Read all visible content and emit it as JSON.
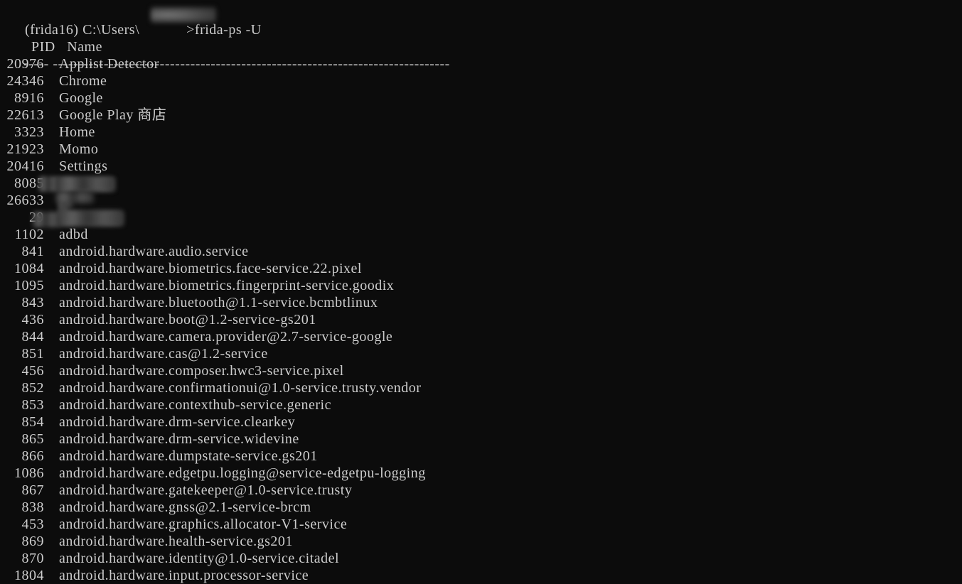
{
  "terminal": {
    "background_color": "#0c0c0c",
    "foreground_color": "#cccccc",
    "prompt": {
      "env": "(frida16)",
      "path_prefix": "C:\\Users\\",
      "path_redacted": "[redacted-username]",
      "path_suffix": ">",
      "command": "frida-ps -U",
      "full_text": "(frida16) C:\\Users\\            >frida-ps -U"
    },
    "header": {
      "pid_label": "PID",
      "name_label": "Name",
      "pid_rule": "-----",
      "name_rule": "------------------------------------------------------------------------------"
    },
    "processes": [
      {
        "pid": "20976",
        "name": "Applist Detector",
        "redacted": false
      },
      {
        "pid": "24346",
        "name": "Chrome",
        "redacted": false
      },
      {
        "pid": "8916",
        "name": "Google",
        "redacted": false
      },
      {
        "pid": "22613",
        "name": "Google Play 商店",
        "redacted": false
      },
      {
        "pid": "3323",
        "name": "Home",
        "redacted": false
      },
      {
        "pid": "21923",
        "name": "Momo",
        "redacted": false
      },
      {
        "pid": "20416",
        "name": "Settings",
        "redacted": false
      },
      {
        "pid": "8085",
        "name": "",
        "redacted": true,
        "redact_width": 78,
        "pid_redacted": true
      },
      {
        "pid": "26633",
        "name": "",
        "redacted": true,
        "redact_width": 20,
        "pid_redacted": false
      },
      {
        "pid": "29",
        "name": "",
        "redacted": true,
        "redact_width": 90,
        "pid_redacted": true
      },
      {
        "pid": "1102",
        "name": "adbd",
        "redacted": false
      },
      {
        "pid": "841",
        "name": "android.hardware.audio.service",
        "redacted": false
      },
      {
        "pid": "1084",
        "name": "android.hardware.biometrics.face-service.22.pixel",
        "redacted": false
      },
      {
        "pid": "1095",
        "name": "android.hardware.biometrics.fingerprint-service.goodix",
        "redacted": false
      },
      {
        "pid": "843",
        "name": "android.hardware.bluetooth@1.1-service.bcmbtlinux",
        "redacted": false
      },
      {
        "pid": "436",
        "name": "android.hardware.boot@1.2-service-gs201",
        "redacted": false
      },
      {
        "pid": "844",
        "name": "android.hardware.camera.provider@2.7-service-google",
        "redacted": false
      },
      {
        "pid": "851",
        "name": "android.hardware.cas@1.2-service",
        "redacted": false
      },
      {
        "pid": "456",
        "name": "android.hardware.composer.hwc3-service.pixel",
        "redacted": false
      },
      {
        "pid": "852",
        "name": "android.hardware.confirmationui@1.0-service.trusty.vendor",
        "redacted": false
      },
      {
        "pid": "853",
        "name": "android.hardware.contexthub-service.generic",
        "redacted": false
      },
      {
        "pid": "854",
        "name": "android.hardware.drm-service.clearkey",
        "redacted": false
      },
      {
        "pid": "865",
        "name": "android.hardware.drm-service.widevine",
        "redacted": false
      },
      {
        "pid": "866",
        "name": "android.hardware.dumpstate-service.gs201",
        "redacted": false
      },
      {
        "pid": "1086",
        "name": "android.hardware.edgetpu.logging@service-edgetpu-logging",
        "redacted": false
      },
      {
        "pid": "867",
        "name": "android.hardware.gatekeeper@1.0-service.trusty",
        "redacted": false
      },
      {
        "pid": "838",
        "name": "android.hardware.gnss@2.1-service-brcm",
        "redacted": false
      },
      {
        "pid": "453",
        "name": "android.hardware.graphics.allocator-V1-service",
        "redacted": false
      },
      {
        "pid": "869",
        "name": "android.hardware.health-service.gs201",
        "redacted": false
      },
      {
        "pid": "870",
        "name": "android.hardware.identity@1.0-service.citadel",
        "redacted": false
      },
      {
        "pid": "1804",
        "name": "android.hardware.input.processor-service",
        "redacted": false
      }
    ]
  }
}
